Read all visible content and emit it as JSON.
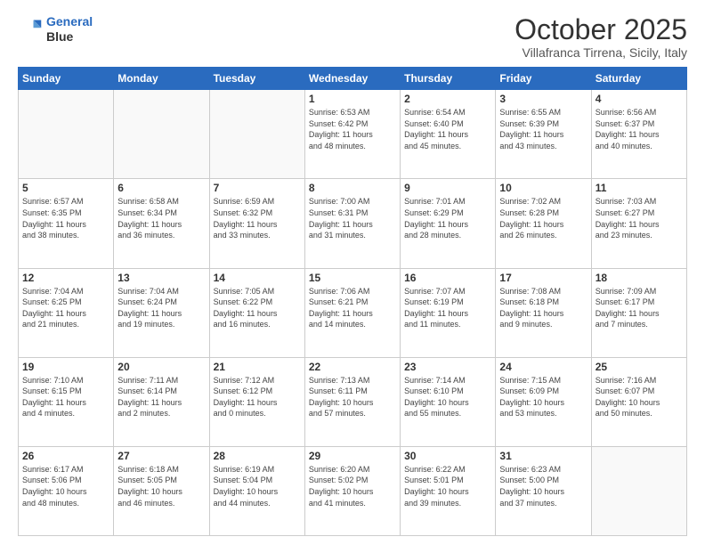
{
  "header": {
    "logo_line1": "General",
    "logo_line2": "Blue",
    "month": "October 2025",
    "location": "Villafranca Tirrena, Sicily, Italy"
  },
  "days_of_week": [
    "Sunday",
    "Monday",
    "Tuesday",
    "Wednesday",
    "Thursday",
    "Friday",
    "Saturday"
  ],
  "weeks": [
    [
      {
        "day": "",
        "info": ""
      },
      {
        "day": "",
        "info": ""
      },
      {
        "day": "",
        "info": ""
      },
      {
        "day": "1",
        "info": "Sunrise: 6:53 AM\nSunset: 6:42 PM\nDaylight: 11 hours\nand 48 minutes."
      },
      {
        "day": "2",
        "info": "Sunrise: 6:54 AM\nSunset: 6:40 PM\nDaylight: 11 hours\nand 45 minutes."
      },
      {
        "day": "3",
        "info": "Sunrise: 6:55 AM\nSunset: 6:39 PM\nDaylight: 11 hours\nand 43 minutes."
      },
      {
        "day": "4",
        "info": "Sunrise: 6:56 AM\nSunset: 6:37 PM\nDaylight: 11 hours\nand 40 minutes."
      }
    ],
    [
      {
        "day": "5",
        "info": "Sunrise: 6:57 AM\nSunset: 6:35 PM\nDaylight: 11 hours\nand 38 minutes."
      },
      {
        "day": "6",
        "info": "Sunrise: 6:58 AM\nSunset: 6:34 PM\nDaylight: 11 hours\nand 36 minutes."
      },
      {
        "day": "7",
        "info": "Sunrise: 6:59 AM\nSunset: 6:32 PM\nDaylight: 11 hours\nand 33 minutes."
      },
      {
        "day": "8",
        "info": "Sunrise: 7:00 AM\nSunset: 6:31 PM\nDaylight: 11 hours\nand 31 minutes."
      },
      {
        "day": "9",
        "info": "Sunrise: 7:01 AM\nSunset: 6:29 PM\nDaylight: 11 hours\nand 28 minutes."
      },
      {
        "day": "10",
        "info": "Sunrise: 7:02 AM\nSunset: 6:28 PM\nDaylight: 11 hours\nand 26 minutes."
      },
      {
        "day": "11",
        "info": "Sunrise: 7:03 AM\nSunset: 6:27 PM\nDaylight: 11 hours\nand 23 minutes."
      }
    ],
    [
      {
        "day": "12",
        "info": "Sunrise: 7:04 AM\nSunset: 6:25 PM\nDaylight: 11 hours\nand 21 minutes."
      },
      {
        "day": "13",
        "info": "Sunrise: 7:04 AM\nSunset: 6:24 PM\nDaylight: 11 hours\nand 19 minutes."
      },
      {
        "day": "14",
        "info": "Sunrise: 7:05 AM\nSunset: 6:22 PM\nDaylight: 11 hours\nand 16 minutes."
      },
      {
        "day": "15",
        "info": "Sunrise: 7:06 AM\nSunset: 6:21 PM\nDaylight: 11 hours\nand 14 minutes."
      },
      {
        "day": "16",
        "info": "Sunrise: 7:07 AM\nSunset: 6:19 PM\nDaylight: 11 hours\nand 11 minutes."
      },
      {
        "day": "17",
        "info": "Sunrise: 7:08 AM\nSunset: 6:18 PM\nDaylight: 11 hours\nand 9 minutes."
      },
      {
        "day": "18",
        "info": "Sunrise: 7:09 AM\nSunset: 6:17 PM\nDaylight: 11 hours\nand 7 minutes."
      }
    ],
    [
      {
        "day": "19",
        "info": "Sunrise: 7:10 AM\nSunset: 6:15 PM\nDaylight: 11 hours\nand 4 minutes."
      },
      {
        "day": "20",
        "info": "Sunrise: 7:11 AM\nSunset: 6:14 PM\nDaylight: 11 hours\nand 2 minutes."
      },
      {
        "day": "21",
        "info": "Sunrise: 7:12 AM\nSunset: 6:12 PM\nDaylight: 11 hours\nand 0 minutes."
      },
      {
        "day": "22",
        "info": "Sunrise: 7:13 AM\nSunset: 6:11 PM\nDaylight: 10 hours\nand 57 minutes."
      },
      {
        "day": "23",
        "info": "Sunrise: 7:14 AM\nSunset: 6:10 PM\nDaylight: 10 hours\nand 55 minutes."
      },
      {
        "day": "24",
        "info": "Sunrise: 7:15 AM\nSunset: 6:09 PM\nDaylight: 10 hours\nand 53 minutes."
      },
      {
        "day": "25",
        "info": "Sunrise: 7:16 AM\nSunset: 6:07 PM\nDaylight: 10 hours\nand 50 minutes."
      }
    ],
    [
      {
        "day": "26",
        "info": "Sunrise: 6:17 AM\nSunset: 5:06 PM\nDaylight: 10 hours\nand 48 minutes."
      },
      {
        "day": "27",
        "info": "Sunrise: 6:18 AM\nSunset: 5:05 PM\nDaylight: 10 hours\nand 46 minutes."
      },
      {
        "day": "28",
        "info": "Sunrise: 6:19 AM\nSunset: 5:04 PM\nDaylight: 10 hours\nand 44 minutes."
      },
      {
        "day": "29",
        "info": "Sunrise: 6:20 AM\nSunset: 5:02 PM\nDaylight: 10 hours\nand 41 minutes."
      },
      {
        "day": "30",
        "info": "Sunrise: 6:22 AM\nSunset: 5:01 PM\nDaylight: 10 hours\nand 39 minutes."
      },
      {
        "day": "31",
        "info": "Sunrise: 6:23 AM\nSunset: 5:00 PM\nDaylight: 10 hours\nand 37 minutes."
      },
      {
        "day": "",
        "info": ""
      }
    ]
  ]
}
